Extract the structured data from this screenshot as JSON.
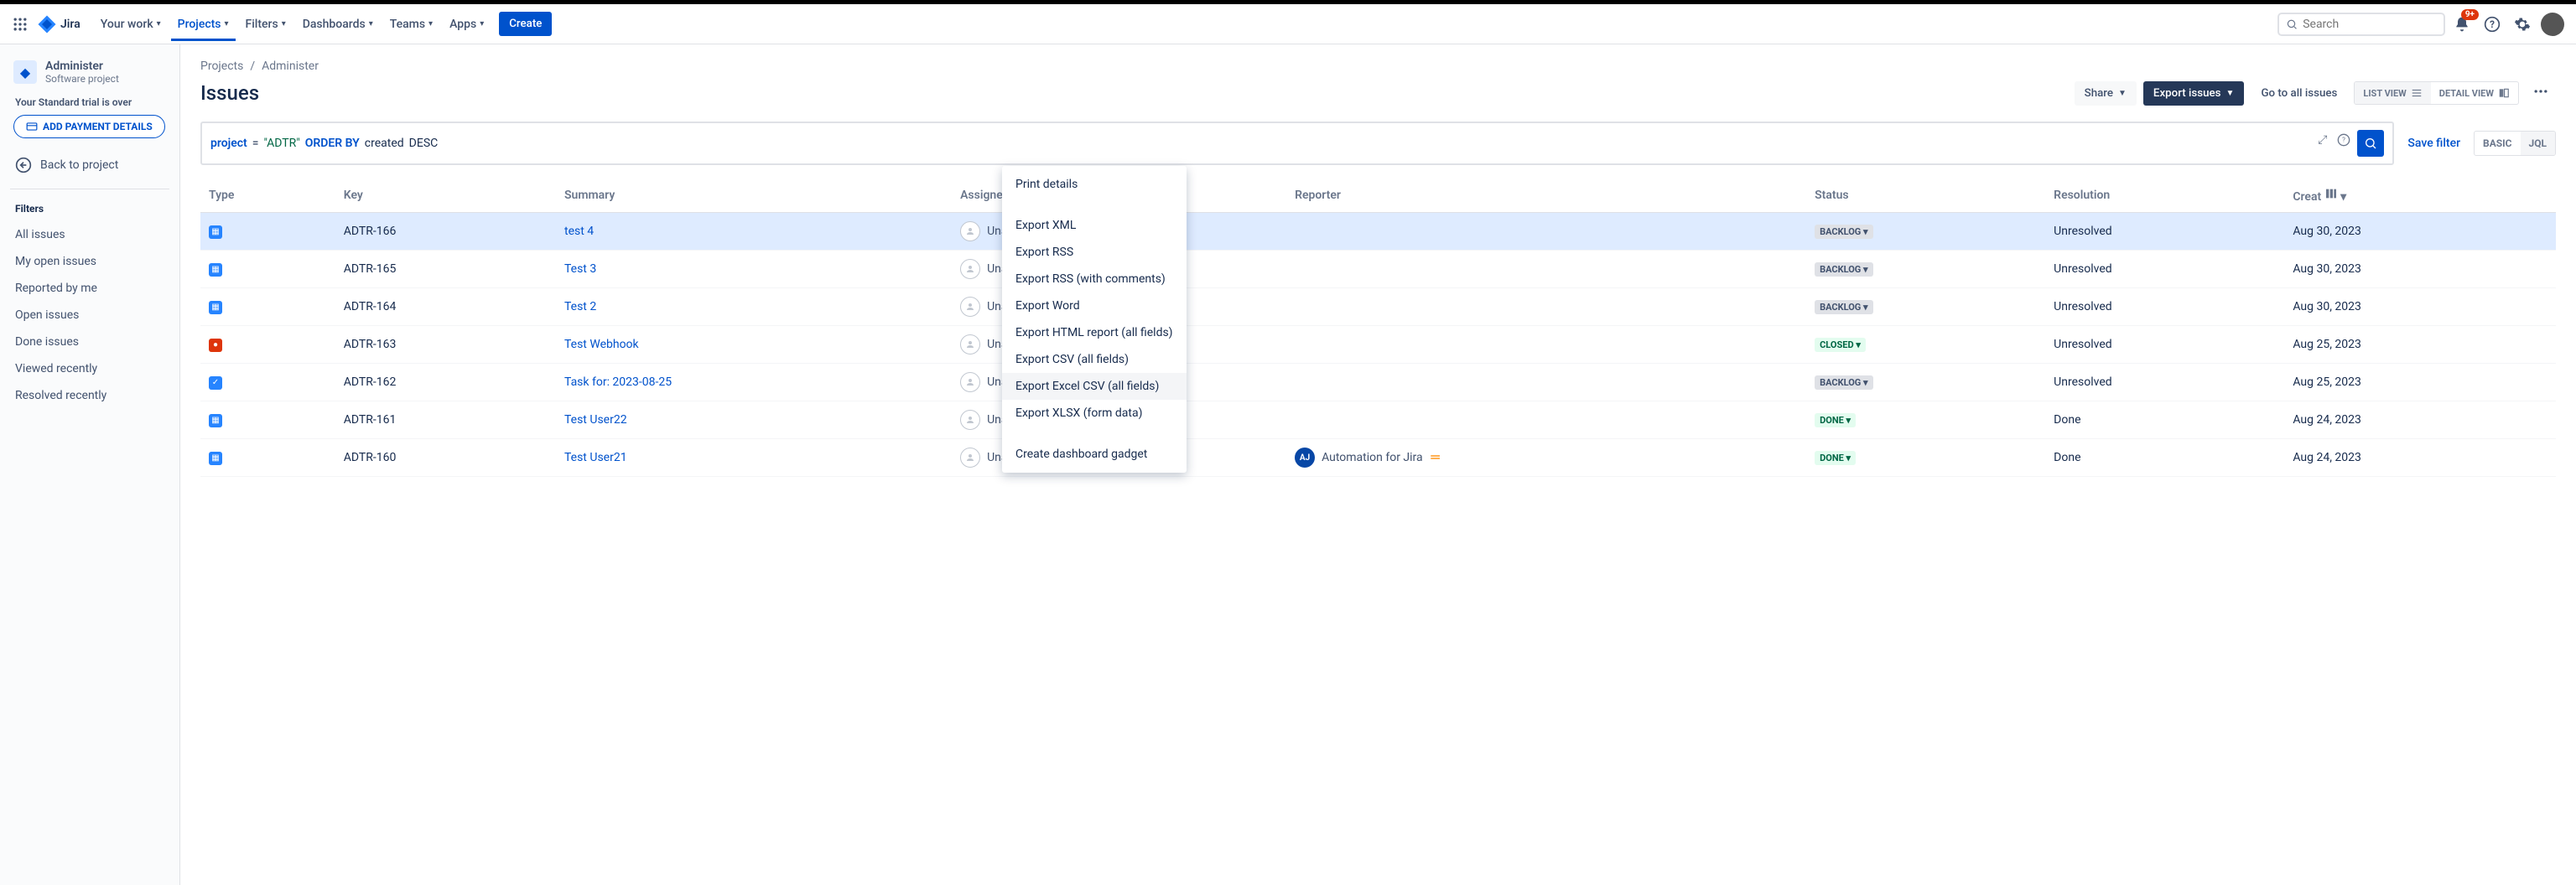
{
  "nav": {
    "logo_text": "Jira",
    "items": [
      "Your work",
      "Projects",
      "Filters",
      "Dashboards",
      "Teams",
      "Apps"
    ],
    "active_index": 1,
    "create": "Create",
    "search_placeholder": "Search",
    "notif_badge": "9+"
  },
  "sidebar": {
    "project_name": "Administer",
    "project_type": "Software project",
    "trial_msg": "Your Standard trial is over",
    "add_payment": "ADD PAYMENT DETAILS",
    "back": "Back to project",
    "filters_heading": "Filters",
    "filters": [
      "All issues",
      "My open issues",
      "Reported by me",
      "Open issues",
      "Done issues",
      "Viewed recently",
      "Resolved recently"
    ]
  },
  "breadcrumb": {
    "root": "Projects",
    "current": "Administer"
  },
  "page_title": "Issues",
  "actions": {
    "share": "Share",
    "export": "Export issues",
    "goto": "Go to all issues",
    "list_view": "LIST VIEW",
    "detail_view": "DETAIL VIEW"
  },
  "jql": {
    "kw_project": "project",
    "eq": "=",
    "val": "\"ADTR\"",
    "kw_order": "ORDER BY",
    "field": "created",
    "dir": "DESC"
  },
  "save_filter": "Save filter",
  "mode": {
    "basic": "BASIC",
    "jql": "JQL"
  },
  "columns": [
    "Type",
    "Key",
    "Summary",
    "Assignee",
    "Reporter",
    "Status",
    "Resolution",
    "Creat"
  ],
  "rows": [
    {
      "type": "task",
      "key": "ADTR-166",
      "summary": "test 4",
      "assignee": "Unassigned",
      "reporter": "",
      "status": "BACKLOG",
      "status_class": "backlog",
      "resolution": "Unresolved",
      "created": "Aug 30, 2023",
      "selected": true
    },
    {
      "type": "task",
      "key": "ADTR-165",
      "summary": "Test 3",
      "assignee": "Unassigned",
      "reporter": "",
      "status": "BACKLOG",
      "status_class": "backlog",
      "resolution": "Unresolved",
      "created": "Aug 30, 2023"
    },
    {
      "type": "task",
      "key": "ADTR-164",
      "summary": "Test 2",
      "assignee": "Unassigned",
      "reporter": "",
      "status": "BACKLOG",
      "status_class": "backlog",
      "resolution": "Unresolved",
      "created": "Aug 30, 2023"
    },
    {
      "type": "bug",
      "key": "ADTR-163",
      "summary": "Test Webhook",
      "assignee": "Unassigned",
      "reporter": "",
      "status": "CLOSED",
      "status_class": "closed",
      "resolution": "Unresolved",
      "created": "Aug 25, 2023"
    },
    {
      "type": "subtask",
      "key": "ADTR-162",
      "summary": "Task for: 2023-08-25",
      "assignee": "Unassigned",
      "reporter": "",
      "status": "BACKLOG",
      "status_class": "backlog",
      "resolution": "Unresolved",
      "created": "Aug 25, 2023"
    },
    {
      "type": "task",
      "key": "ADTR-161",
      "summary": "Test User22",
      "assignee": "Unassigned",
      "reporter": "",
      "status": "DONE",
      "status_class": "done",
      "resolution": "Done",
      "created": "Aug 24, 2023"
    },
    {
      "type": "task",
      "key": "ADTR-160",
      "summary": "Test User21",
      "assignee": "Unassigned",
      "reporter": "Automation for Jira",
      "reporter_avatar": "AJ",
      "prio": "med",
      "status": "DONE",
      "status_class": "done",
      "resolution": "Done",
      "created": "Aug 24, 2023"
    }
  ],
  "export_menu": [
    {
      "label": "Print details",
      "sep_after": true
    },
    {
      "label": "Export XML"
    },
    {
      "label": "Export RSS"
    },
    {
      "label": "Export RSS (with comments)"
    },
    {
      "label": "Export Word"
    },
    {
      "label": "Export HTML report (all fields)"
    },
    {
      "label": "Export CSV (all fields)"
    },
    {
      "label": "Export Excel CSV (all fields)",
      "hovered": true
    },
    {
      "label": "Export XLSX (form data)",
      "sep_after": true
    },
    {
      "label": "Create dashboard gadget"
    }
  ]
}
